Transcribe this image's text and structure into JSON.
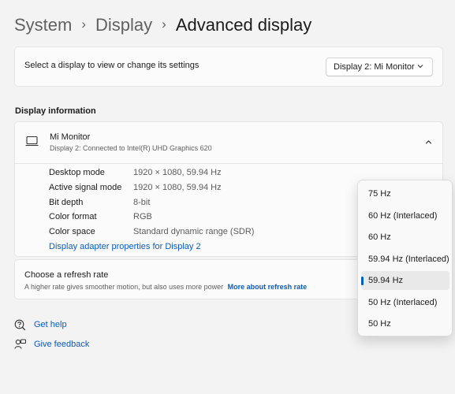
{
  "breadcrumb": {
    "item1": "System",
    "item2": "Display",
    "current": "Advanced display"
  },
  "display_select": {
    "label": "Select a display to view or change its settings",
    "value": "Display 2: Mi Monitor"
  },
  "display_info": {
    "section_title": "Display information",
    "monitor_name": "Mi Monitor",
    "monitor_sub": "Display 2: Connected to Intel(R) UHD Graphics 620",
    "rows": [
      {
        "key": "Desktop mode",
        "value": "1920 × 1080, 59.94 Hz"
      },
      {
        "key": "Active signal mode",
        "value": "1920 × 1080, 59.94 Hz"
      },
      {
        "key": "Bit depth",
        "value": "8-bit"
      },
      {
        "key": "Color format",
        "value": "RGB"
      },
      {
        "key": "Color space",
        "value": "Standard dynamic range (SDR)"
      }
    ],
    "adapter_link": "Display adapter properties for Display 2"
  },
  "refresh": {
    "title": "Choose a refresh rate",
    "desc": "A higher rate gives smoother motion, but also uses more power",
    "link": "More about refresh rate",
    "options": [
      "75 Hz",
      "60 Hz (Interlaced)",
      "60 Hz",
      "59.94 Hz (Interlaced)",
      "59.94 Hz",
      "50 Hz (Interlaced)",
      "50 Hz"
    ],
    "selected": "59.94 Hz"
  },
  "help": {
    "get_help": "Get help",
    "give_feedback": "Give feedback"
  },
  "colors": {
    "accent": "#005fb8",
    "link": "#0f5bb0"
  },
  "icons": [
    "monitor-icon",
    "chevron-down-icon",
    "chevron-up-icon",
    "help-icon",
    "feedback-icon"
  ]
}
